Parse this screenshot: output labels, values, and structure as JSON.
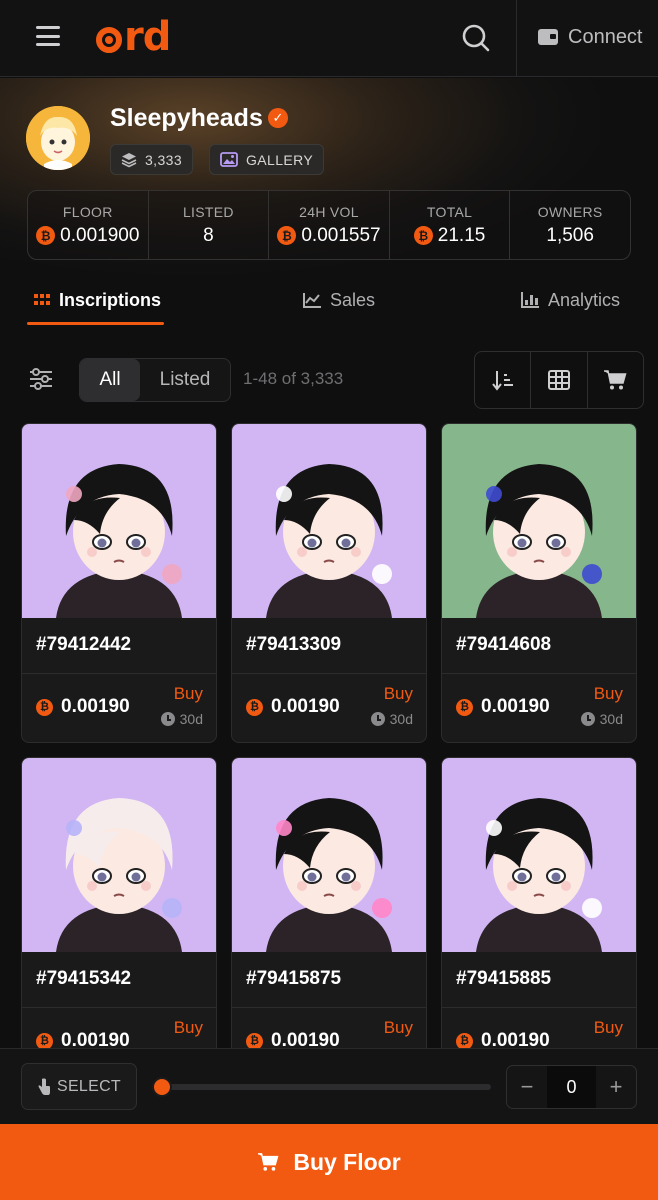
{
  "header": {
    "logo_text": "rd",
    "connect_label": "Connect"
  },
  "collection": {
    "name": "Sleepyheads",
    "supply": "3,333",
    "gallery_label": "GALLERY"
  },
  "stats": [
    {
      "label": "FLOOR",
      "value": "0.001900",
      "btc": true
    },
    {
      "label": "LISTED",
      "value": "8",
      "btc": false
    },
    {
      "label": "24H VOL",
      "value": "0.001557",
      "btc": true
    },
    {
      "label": "TOTAL",
      "value": "21.15",
      "btc": true
    },
    {
      "label": "OWNERS",
      "value": "1,506",
      "btc": false
    }
  ],
  "tabs": {
    "inscriptions": "Inscriptions",
    "sales": "Sales",
    "analytics": "Analytics"
  },
  "filter": {
    "all_label": "All",
    "listed_label": "Listed",
    "count_text": "1-48 of 3,333"
  },
  "cards": [
    {
      "id": "#79412442",
      "price": "0.00190",
      "buy": "Buy",
      "expiry": "30d",
      "bg": "#d2b6f4",
      "hair": "black",
      "accent": "#f0a6c0"
    },
    {
      "id": "#79413309",
      "price": "0.00190",
      "buy": "Buy",
      "expiry": "30d",
      "bg": "#d2b6f4",
      "hair": "black",
      "accent": "#ffffff"
    },
    {
      "id": "#79414608",
      "price": "0.00190",
      "buy": "Buy",
      "expiry": "30d",
      "bg": "#86b68c",
      "hair": "black",
      "accent": "#3e4ad0"
    },
    {
      "id": "#79415342",
      "price": "0.00190",
      "buy": "Buy",
      "expiry": "",
      "bg": "#d2b6f4",
      "hair": "white",
      "accent": "#b6b2f8"
    },
    {
      "id": "#79415875",
      "price": "0.00190",
      "buy": "Buy",
      "expiry": "",
      "bg": "#d2b6f4",
      "hair": "black",
      "accent": "#ff86c8"
    },
    {
      "id": "#79415885",
      "price": "0.00190",
      "buy": "Buy",
      "expiry": "",
      "bg": "#d2b6f4",
      "hair": "black",
      "accent": "#ffffff"
    }
  ],
  "selection": {
    "select_label": "SELECT",
    "quantity": "0",
    "minus": "−",
    "plus": "+"
  },
  "buy_floor_label": "Buy Floor",
  "colors": {
    "accent": "#f25a12",
    "background": "#0f0f10"
  }
}
